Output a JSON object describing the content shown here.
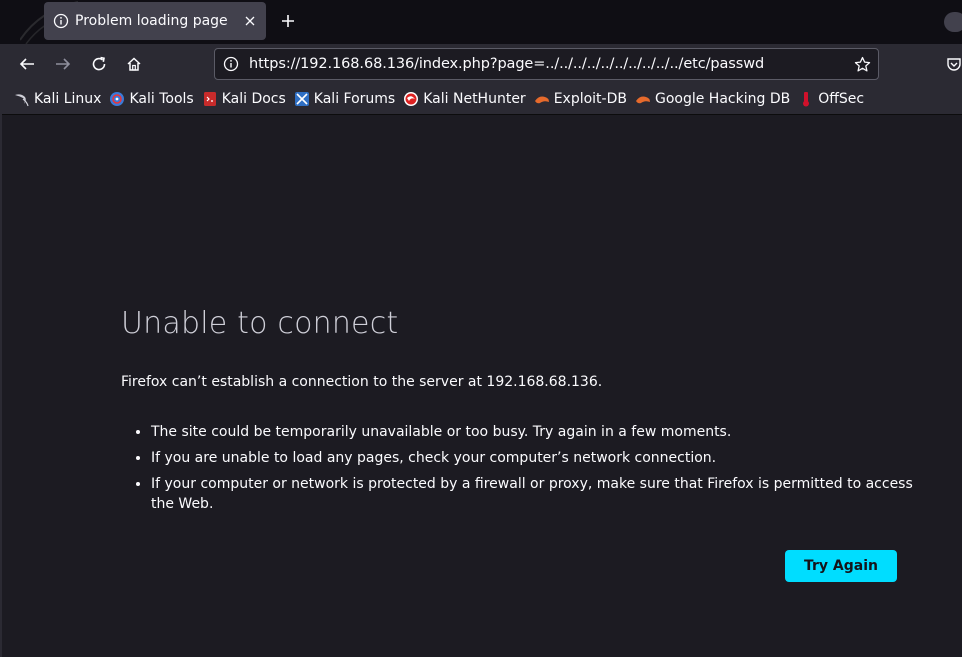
{
  "tab": {
    "title": "Problem loading page"
  },
  "navbar": {
    "url": "https://192.168.68.136/index.php?page=../../../../../../../../../../etc/passwd"
  },
  "bookmarks": [
    {
      "label": "Kali Linux",
      "icon": "kali-dragon-icon"
    },
    {
      "label": "Kali Tools",
      "icon": "kali-tools-icon"
    },
    {
      "label": "Kali Docs",
      "icon": "kali-docs-icon"
    },
    {
      "label": "Kali Forums",
      "icon": "kali-forums-icon"
    },
    {
      "label": "Kali NetHunter",
      "icon": "kali-nethunter-icon"
    },
    {
      "label": "Exploit-DB",
      "icon": "exploit-db-icon"
    },
    {
      "label": "Google Hacking DB",
      "icon": "ghdb-icon"
    },
    {
      "label": "OffSec",
      "icon": "offsec-icon"
    }
  ],
  "error": {
    "title": "Unable to connect",
    "description": "Firefox can’t establish a connection to the server at 192.168.68.136.",
    "items": [
      "The site could be temporarily unavailable or too busy. Try again in a few moments.",
      "If you are unable to load any pages, check your computer’s network connection.",
      "If your computer or network is protected by a firewall or proxy, make sure that Firefox is permitted to access the Web."
    ],
    "button_label": "Try Again"
  },
  "colors": {
    "page_bg": "#1c1b22",
    "toolbar_bg": "#2b2a33",
    "tab_bg": "#42414d",
    "accent_button": "#00ddff",
    "exploit_db_orange": "#e66a2c",
    "offsec_red": "#d0112b"
  }
}
